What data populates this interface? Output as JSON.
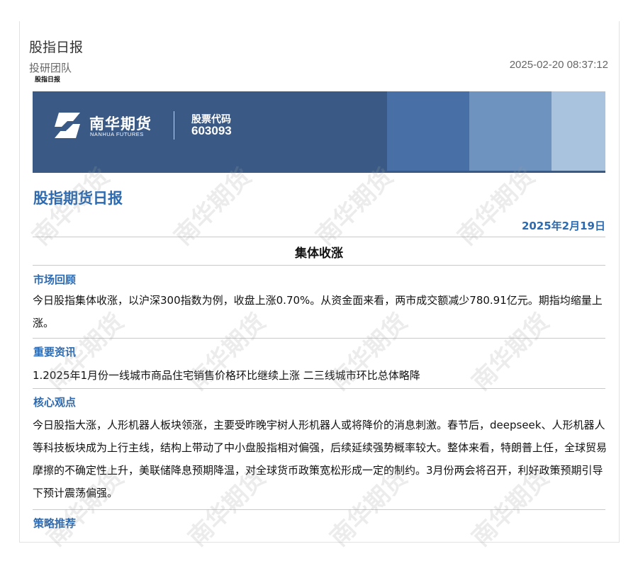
{
  "header": {
    "title": "股指日报",
    "author": "投研团队",
    "timestamp": "2025-02-20 08:37:12",
    "tag": "股指日报"
  },
  "banner": {
    "company_cn": "南华期货",
    "company_en": "NANHUA FUTURES",
    "stock_label": "股票代码",
    "stock_code": "603093",
    "colors": {
      "base": "#3a5a85",
      "block1": "#4870a6",
      "block2": "#6e93be",
      "block3": "#a9c3de"
    }
  },
  "report": {
    "title": "股指期货日报",
    "date": "2025年2月19日",
    "headline": "集体收涨"
  },
  "sections": [
    {
      "heading": "市场回顾",
      "body": "今日股指集体收涨，以沪深300指数为例，收盘上涨0.70%。从资金面来看，两市成交额减少780.91亿元。期指均缩量上涨。"
    },
    {
      "heading": "重要资讯",
      "body": "1.2025年1月份一线城市商品住宅销售价格环比继续上涨 二三线城市环比总体略降"
    },
    {
      "heading": "核心观点",
      "body": "今日股指大涨，人形机器人板块领涨，主要受昨晚宇树人形机器人或将降价的消息刺激。春节后，deepseek、人形机器人等科技板块成为上行主线，结构上带动了中小盘股指相对偏强，后续延续强势概率较大。整体来看，特朗普上任，全球贸易摩擦的不确定性上升，美联储降息预期降温，对全球货币政策宽松形成一定的制约。3月份两会将召开，利好政策预期引导下预计震荡偏强。"
    },
    {
      "heading": "策略推荐",
      "body": ""
    }
  ],
  "watermark": "南华期货",
  "accent_color": "#2d6ab0"
}
